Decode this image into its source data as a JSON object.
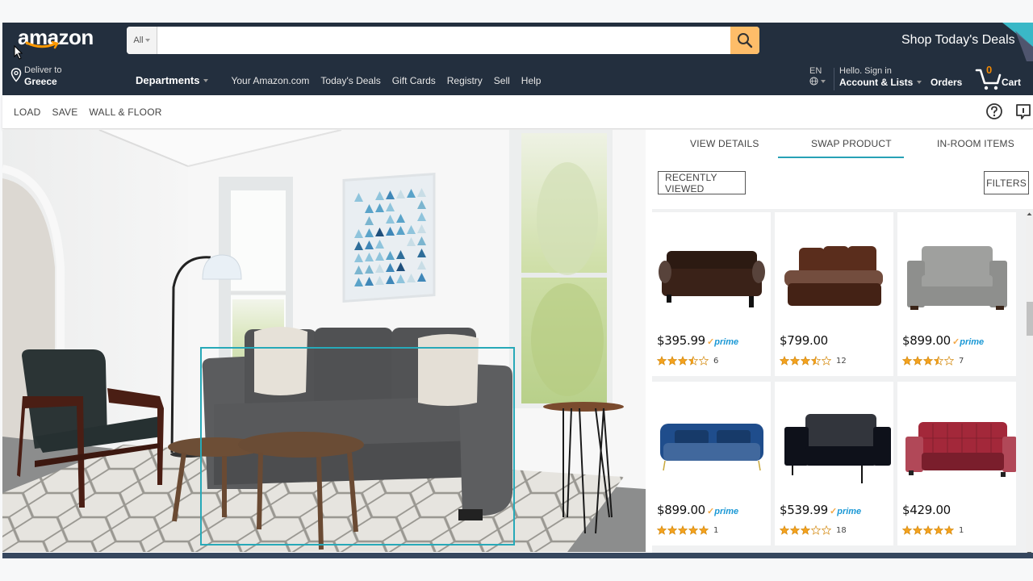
{
  "header": {
    "logo": "amazon",
    "search": {
      "category": "All",
      "value": "",
      "placeholder": ""
    },
    "promo": "Shop Today's Deals",
    "deliver": {
      "line1": "Deliver to",
      "line2": "Greece"
    },
    "departments": "Departments",
    "nav_links": [
      "Your Amazon.com",
      "Today's Deals",
      "Gift Cards",
      "Registry",
      "Sell",
      "Help"
    ],
    "language": "EN",
    "account": {
      "line1": "Hello. Sign in",
      "line2": "Account & Lists"
    },
    "orders": "Orders",
    "cart": {
      "count": "0",
      "label": "Cart"
    }
  },
  "toolbar": {
    "items": [
      "LOAD",
      "SAVE",
      "WALL & FLOOR"
    ],
    "icons": [
      "help-icon",
      "feedback-icon"
    ]
  },
  "panel": {
    "tabs": [
      "VIEW DETAILS",
      "SWAP PRODUCT",
      "IN-ROOM ITEMS"
    ],
    "active_tab": "SWAP PRODUCT",
    "recently_viewed": "RECENTLY VIEWED",
    "filters": "FILTERS",
    "accent_color": "#27a1b5",
    "products": [
      {
        "price": "$395.99",
        "prime": true,
        "rating": 3.5,
        "reviews": "6",
        "color": "#3a2218",
        "style": "rolled-arm"
      },
      {
        "price": "$799.00",
        "prime": false,
        "rating": 3.5,
        "reviews": "12",
        "color": "#5a2d1c",
        "style": "leather-recliner"
      },
      {
        "price": "$899.00",
        "prime": true,
        "rating": 3.5,
        "reviews": "7",
        "color": "#8e8f8d",
        "style": "loveseat"
      },
      {
        "price": "$899.00",
        "prime": true,
        "rating": 5,
        "reviews": "1",
        "color": "#1f4d8c",
        "style": "tuxedo"
      },
      {
        "price": "$539.99",
        "prime": true,
        "rating": 3,
        "reviews": "18",
        "color": "#0e111a",
        "style": "modern"
      },
      {
        "price": "$429.00",
        "prime": false,
        "rating": 5,
        "reviews": "1",
        "color": "#a3283a",
        "style": "tufted"
      }
    ],
    "prime_label": "prime"
  },
  "scene": {
    "selected_item": "sofa",
    "selection_color": "#27a9b8"
  }
}
